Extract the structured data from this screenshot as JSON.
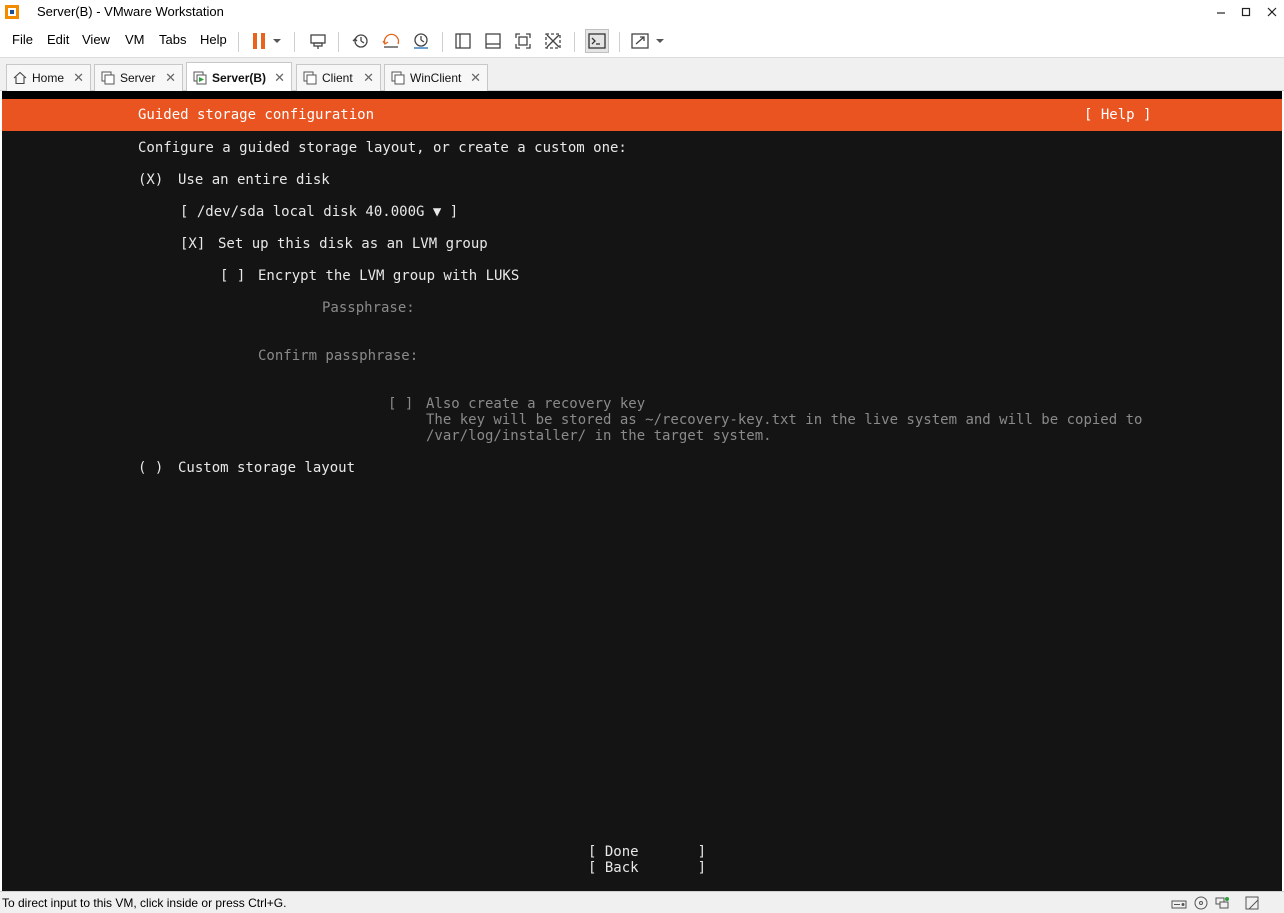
{
  "window": {
    "title": "Server(B) - VMware Workstation",
    "minimize_icon": "minimize-icon",
    "maximize_icon": "maximize-icon",
    "close_icon": "close-icon"
  },
  "menu": {
    "items": [
      "File",
      "Edit",
      "View",
      "VM",
      "Tabs",
      "Help"
    ]
  },
  "toolbar": {
    "icons": [
      "pause-icon",
      "dropdown-arrow-icon",
      "send-keys-icon",
      "snapshot-icon",
      "revert-snapshot-icon",
      "snapshot-manager-icon",
      "library-icon",
      "thumbnail-bar-icon",
      "full-screen-icon",
      "unity-icon",
      "console-view-icon",
      "stretch-guest-icon",
      "dropdown-arrow-icon"
    ],
    "accent": "#e8641c"
  },
  "tabs": [
    {
      "label": "Home",
      "icon": "home-icon",
      "active": false
    },
    {
      "label": "Server",
      "icon": "vm-icon",
      "active": false
    },
    {
      "label": "Server(B)",
      "icon": "vm-running-icon",
      "active": true
    },
    {
      "label": "Client",
      "icon": "vm-icon",
      "active": false
    },
    {
      "label": "WinClient",
      "icon": "vm-icon",
      "active": false
    }
  ],
  "installer": {
    "header_title": "Guided storage configuration",
    "help": "[ Help ]",
    "intro": "Configure a guided storage layout, or create a custom one:",
    "entire_disk_radio": "(X)",
    "entire_disk_label": "Use an entire disk",
    "disk_select": "[ /dev/sda local disk 40.000G ▼ ]",
    "lvm_checkbox": "[X]",
    "lvm_label": "Set up this disk as an LVM group",
    "encrypt_checkbox": "[ ]",
    "encrypt_label": "Encrypt the LVM group with LUKS",
    "passphrase_label": "Passphrase:",
    "confirm_label": "Confirm passphrase:",
    "recovery_checkbox": "[ ]",
    "recovery_label": "Also create a recovery key",
    "recovery_desc_1": "The key will be stored as ~/recovery-key.txt in the live system and will be copied to",
    "recovery_desc_2": "/var/log/installer/ in the target system.",
    "custom_radio": "( )",
    "custom_label": "Custom storage layout",
    "done_button": "[ Done       ]",
    "back_button": "[ Back       ]",
    "header_color": "#e95420"
  },
  "status": {
    "text": "To direct input to this VM, click inside or press Ctrl+G.",
    "icons": [
      "hard-disk-icon",
      "cd-dvd-icon",
      "network-icon",
      "message-icon"
    ]
  }
}
